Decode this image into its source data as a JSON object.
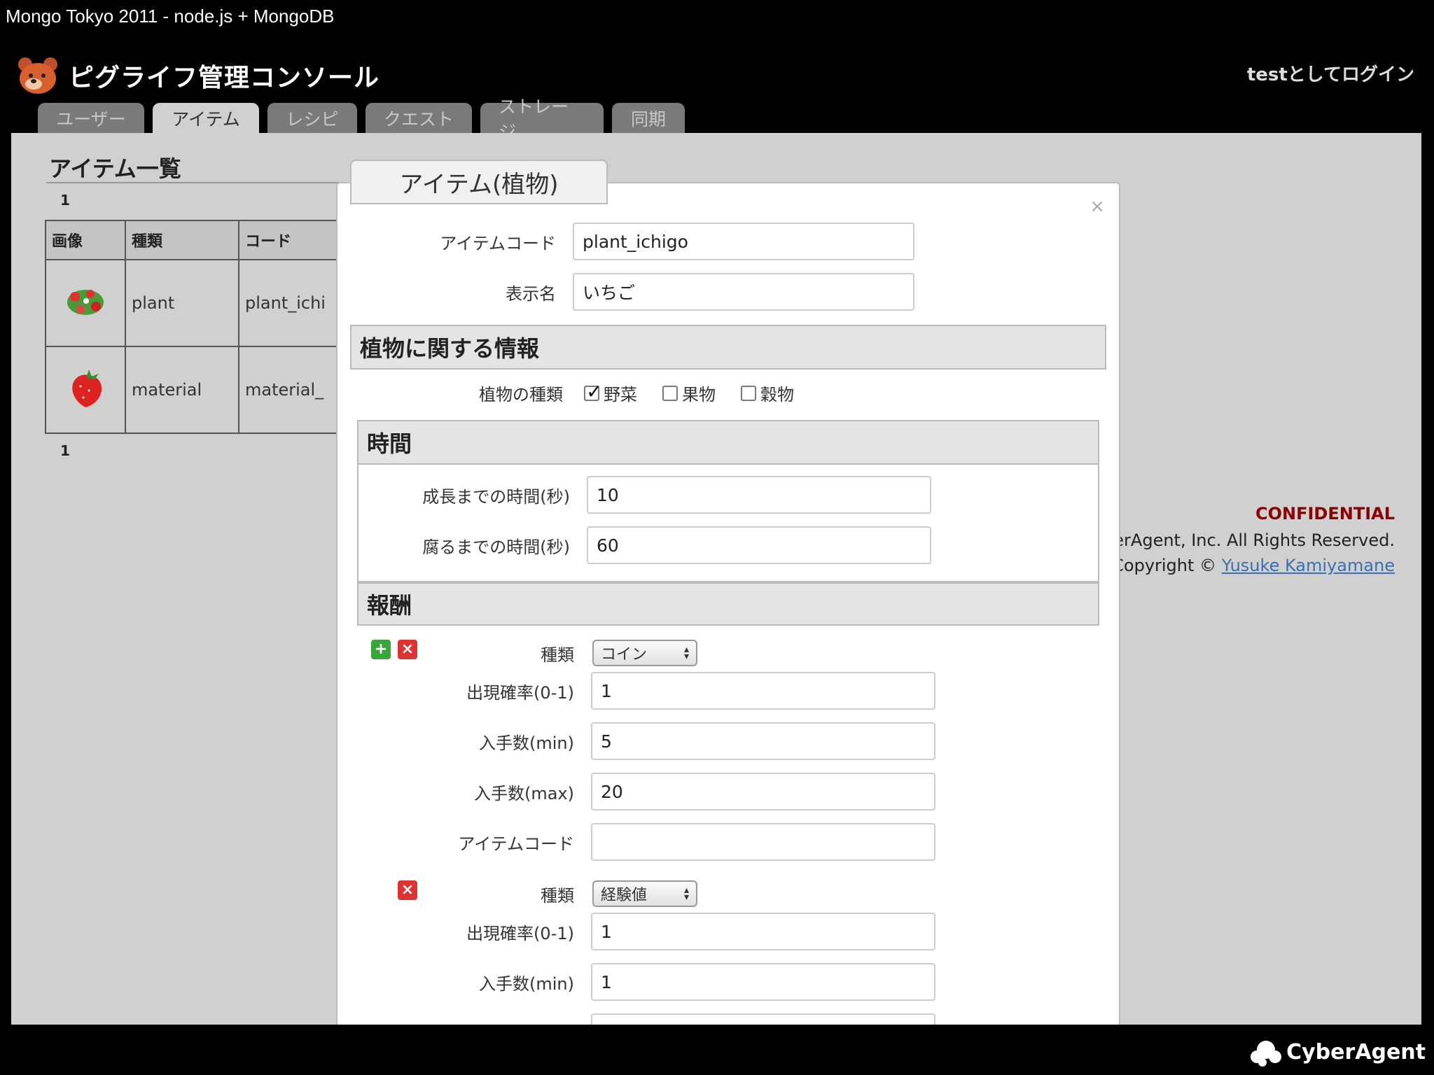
{
  "slide": {
    "title": "Mongo Tokyo 2011 - node.js + MongoDB",
    "company_logo": "CyberAgent"
  },
  "app": {
    "name": "ピグライフ管理コンソール",
    "login_status": "testとしてログイン",
    "tabs": [
      {
        "label": "ユーザー",
        "active": false
      },
      {
        "label": "アイテム",
        "active": true
      },
      {
        "label": "レシピ",
        "active": false
      },
      {
        "label": "クエスト",
        "active": false
      },
      {
        "label": "ストレージ",
        "active": false
      },
      {
        "label": "同期",
        "active": false
      }
    ]
  },
  "list": {
    "heading": "アイテム一覧",
    "page_top": "1",
    "page_bottom": "1",
    "columns": [
      "画像",
      "種類",
      "コード"
    ],
    "rows": [
      {
        "image": "plant-sprite-icon",
        "type": "plant",
        "code": "plant_ichi"
      },
      {
        "image": "strawberry-icon",
        "type": "material",
        "code": "material_"
      }
    ]
  },
  "footer": {
    "confidential": "CONFIDENTIAL",
    "rights": "yberAgent, Inc. All Rights Reserved.",
    "copyright_prefix": "re Copyright ©",
    "copyright_link": "Yusuke Kamiyamane"
  },
  "modal": {
    "title": "アイテム(植物)",
    "close": "×",
    "item_code_label": "アイテムコード",
    "item_code_value": "plant_ichigo",
    "display_name_label": "表示名",
    "display_name_value": "いちご",
    "plant_section": {
      "title": "植物に関する情報",
      "kind_label": "植物の種類",
      "kinds": [
        {
          "label": "野菜",
          "checked": true
        },
        {
          "label": "果物",
          "checked": false
        },
        {
          "label": "穀物",
          "checked": false
        }
      ]
    },
    "time_section": {
      "title": "時間",
      "grow_label": "成長までの時間(秒)",
      "grow_value": "10",
      "rot_label": "腐るまでの時間(秒)",
      "rot_value": "60"
    },
    "reward_section": {
      "title": "報酬",
      "rewards": [
        {
          "type_label": "種類",
          "type_value": "コイン",
          "prob_label": "出現確率(0-1)",
          "prob_value": "1",
          "min_label": "入手数(min)",
          "min_value": "5",
          "max_label": "入手数(max)",
          "max_value": "20",
          "code_label": "アイテムコード",
          "code_value": ""
        },
        {
          "type_label": "種類",
          "type_value": "経験値",
          "prob_label": "出現確率(0-1)",
          "prob_value": "1",
          "min_label": "入手数(min)",
          "min_value": "1"
        }
      ]
    }
  }
}
